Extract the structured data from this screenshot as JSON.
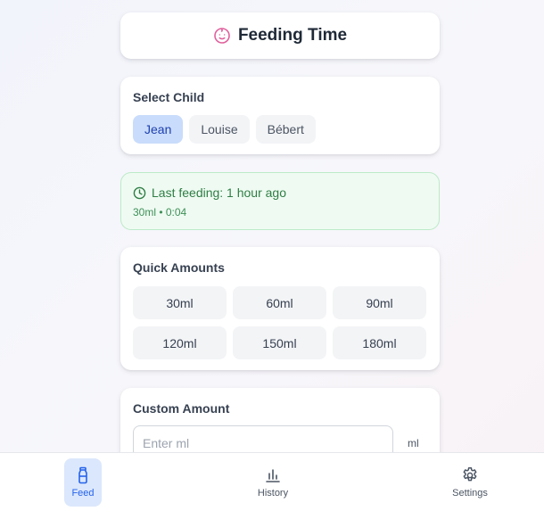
{
  "header": {
    "title": "Feeding Time",
    "icon": "baby-face-icon"
  },
  "select_child": {
    "title": "Select Child",
    "children": [
      "Jean",
      "Louise",
      "Bébert"
    ],
    "selected": "Jean"
  },
  "last_feeding": {
    "text": "Last feeding: 1 hour ago",
    "detail": "30ml • 0:04",
    "icon": "clock-icon"
  },
  "quick_amounts": {
    "title": "Quick Amounts",
    "amounts": [
      "30ml",
      "60ml",
      "90ml",
      "120ml",
      "150ml",
      "180ml"
    ]
  },
  "custom_amount": {
    "title": "Custom Amount",
    "placeholder": "Enter ml",
    "unit": "ml"
  },
  "nav": {
    "feed": "Feed",
    "history": "History",
    "settings": "Settings",
    "active": "Feed"
  },
  "colors": {
    "accent": "#2563eb",
    "accent_bg": "#dbe7fc",
    "success_text": "#2f7d45",
    "success_bg": "#effbf2",
    "icon_pink": "#e0609c"
  }
}
